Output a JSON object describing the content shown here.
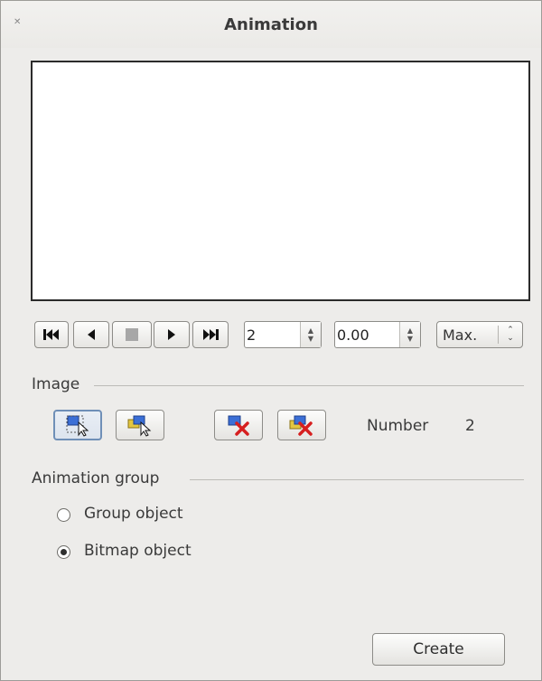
{
  "window": {
    "title": "Animation"
  },
  "icons": {
    "close": "close-icon",
    "first": "skip-first-icon",
    "back": "play-backward-icon",
    "stop": "stop-icon",
    "play": "play-icon",
    "last": "skip-last-icon",
    "apply_object": "apply-object-icon",
    "apply_objects_individually": "apply-objects-individually-icon",
    "delete_current": "delete-current-image-icon",
    "delete_all": "delete-all-images-icon"
  },
  "controls": {
    "frame_value": "2",
    "duration_value": "0.00",
    "loop_value": "Max."
  },
  "image_section": {
    "label": "Image",
    "number_label": "Number",
    "number_value": "2"
  },
  "animation_group": {
    "label": "Animation group",
    "options": [
      {
        "label": "Group object",
        "selected": false
      },
      {
        "label": "Bitmap object",
        "selected": true
      }
    ]
  },
  "buttons": {
    "create": "Create"
  },
  "colors": {
    "accent": "#6f8fb7",
    "delete": "#d61f1f"
  }
}
